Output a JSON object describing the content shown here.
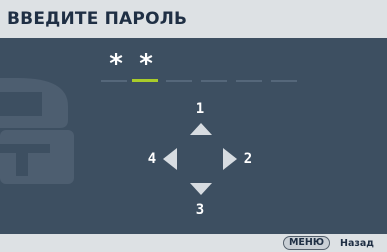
{
  "header": {
    "title": "ВВЕДИТЕ ПАРОЛЬ"
  },
  "password": {
    "entered": [
      "*",
      "*"
    ],
    "total_slots": 6,
    "active_slot_index": 1
  },
  "keypad": {
    "up_label": "1",
    "right_label": "2",
    "down_label": "3",
    "left_label": "4"
  },
  "footer": {
    "menu_key_label": "МЕНЮ",
    "action_label": "Назад"
  },
  "colors": {
    "background": "#3d4f61",
    "bar": "#dde1e4",
    "active_slot": "#a9cc2a",
    "inactive_slot": "#55677a",
    "lock_watermark": "#4d5e70"
  },
  "icons": [
    "lock-icon",
    "arrow-up-icon",
    "arrow-right-icon",
    "arrow-down-icon",
    "arrow-left-icon"
  ]
}
